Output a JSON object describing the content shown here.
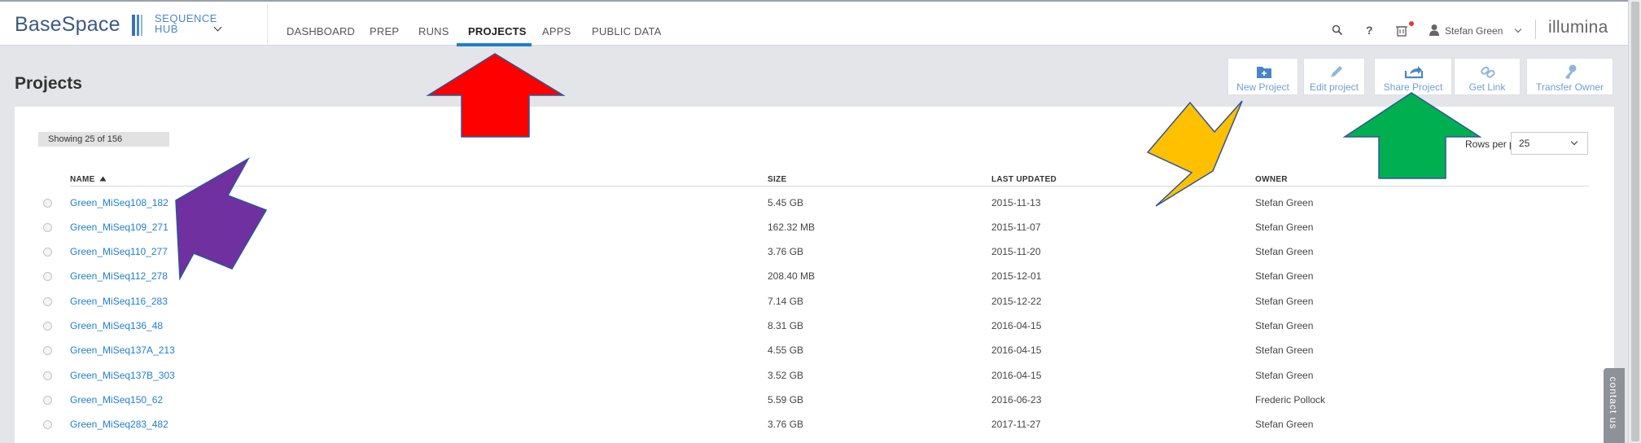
{
  "header": {
    "logo_text": "BaseSpace",
    "hub_line1": "SEQUENCE",
    "hub_line2": "HUB",
    "nav": [
      {
        "label": "DASHBOARD",
        "active": false
      },
      {
        "label": "PREP",
        "active": false
      },
      {
        "label": "RUNS",
        "active": false
      },
      {
        "label": "PROJECTS",
        "active": true
      },
      {
        "label": "APPS",
        "active": false
      },
      {
        "label": "PUBLIC DATA",
        "active": false
      }
    ],
    "icons": [
      "search-icon",
      "help-icon",
      "notifications-icon",
      "user-icon"
    ],
    "user_name": "Stefan Green",
    "brand": "illumina"
  },
  "page": {
    "title": "Projects"
  },
  "toolbar": [
    {
      "label": "New Project",
      "icon": "new-folder-icon"
    },
    {
      "label": "Edit project",
      "icon": "pencil-icon"
    },
    {
      "label": "Share Project",
      "icon": "share-icon"
    },
    {
      "label": "Get Link",
      "icon": "link-icon"
    },
    {
      "label": "Transfer Owner",
      "icon": "key-icon"
    }
  ],
  "list": {
    "showing_text": "Showing 25 of 156",
    "rows_per_page_label": "Rows per page",
    "rows_per_page_value": "25",
    "columns": {
      "name": "NAME",
      "size": "SIZE",
      "last_updated": "LAST UPDATED",
      "owner": "OWNER"
    },
    "sort_column": "NAME",
    "sort_direction": "ascending",
    "rows": [
      {
        "name": "Green_MiSeq108_182",
        "size": "5.45 GB",
        "last_updated": "2015-11-13",
        "owner": "Stefan Green"
      },
      {
        "name": "Green_MiSeq109_271",
        "size": "162.32 MB",
        "last_updated": "2015-11-07",
        "owner": "Stefan Green"
      },
      {
        "name": "Green_MiSeq110_277",
        "size": "3.76 GB",
        "last_updated": "2015-11-20",
        "owner": "Stefan Green"
      },
      {
        "name": "Green_MiSeq112_278",
        "size": "208.40 MB",
        "last_updated": "2015-12-01",
        "owner": "Stefan Green"
      },
      {
        "name": "Green_MiSeq116_283",
        "size": "7.14 GB",
        "last_updated": "2015-12-22",
        "owner": "Stefan Green"
      },
      {
        "name": "Green_MiSeq136_48",
        "size": "8.31 GB",
        "last_updated": "2016-04-15",
        "owner": "Stefan Green"
      },
      {
        "name": "Green_MiSeq137A_213",
        "size": "4.55 GB",
        "last_updated": "2016-04-15",
        "owner": "Stefan Green"
      },
      {
        "name": "Green_MiSeq137B_303",
        "size": "3.52 GB",
        "last_updated": "2016-04-15",
        "owner": "Stefan Green"
      },
      {
        "name": "Green_MiSeq150_62",
        "size": "5.59 GB",
        "last_updated": "2016-06-23",
        "owner": "Frederic Pollock"
      },
      {
        "name": "Green_MiSeq283_482",
        "size": "3.76 GB",
        "last_updated": "2017-11-27",
        "owner": "Stefan Green"
      }
    ]
  },
  "contact_tab": "contact us",
  "annotations": {
    "arrow_colors": {
      "red": "#ff0000",
      "purple": "#7030a0",
      "yellow": "#ffc000",
      "green": "#00b050"
    },
    "arrow_outline": "#2f5597"
  },
  "colors": {
    "accent": "#1f7fcf",
    "link": "#1f7fcf",
    "toolbar_label": "#6f9fcf"
  }
}
